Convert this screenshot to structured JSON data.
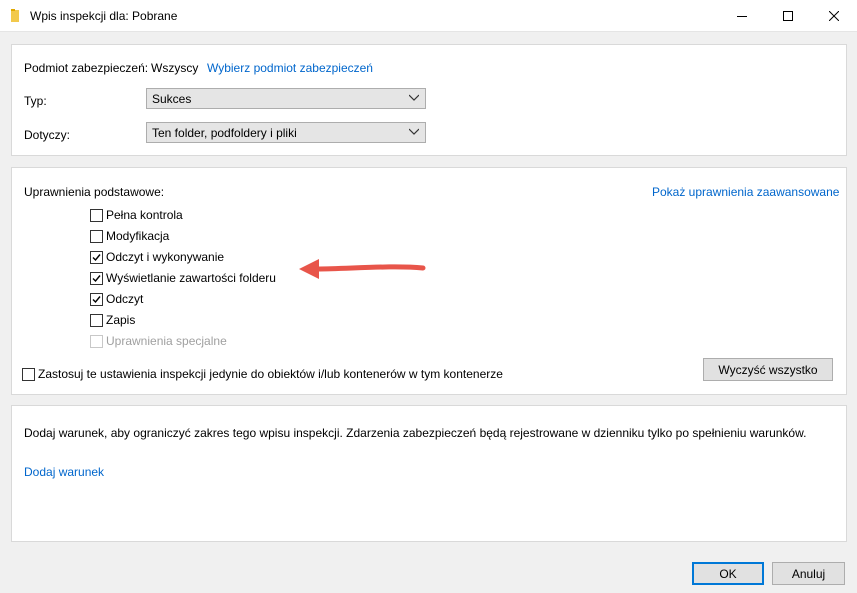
{
  "window": {
    "title": "Wpis inspekcji dla: Pobrane"
  },
  "principal": {
    "label": "Podmiot zabezpieczeń:",
    "value": "Wszyscy",
    "select_link": "Wybierz podmiot zabezpieczeń"
  },
  "type_field": {
    "label": "Typ:",
    "value": "Sukces"
  },
  "applies_field": {
    "label": "Dotyczy:",
    "value": "Ten folder, podfoldery i pliki"
  },
  "permissions": {
    "heading": "Uprawnienia podstawowe:",
    "advanced_link": "Pokaż uprawnienia zaawansowane",
    "items": [
      {
        "label": "Pełna kontrola",
        "checked": false,
        "disabled": false
      },
      {
        "label": "Modyfikacja",
        "checked": false,
        "disabled": false
      },
      {
        "label": "Odczyt i wykonywanie",
        "checked": true,
        "disabled": false
      },
      {
        "label": "Wyświetlanie zawartości folderu",
        "checked": true,
        "disabled": false
      },
      {
        "label": "Odczyt",
        "checked": true,
        "disabled": false
      },
      {
        "label": "Zapis",
        "checked": false,
        "disabled": false
      },
      {
        "label": "Uprawnienia specjalne",
        "checked": false,
        "disabled": true
      }
    ],
    "apply_only": {
      "label": "Zastosuj te ustawienia inspekcji jedynie do obiektów i/lub kontenerów w tym kontenerze",
      "checked": false
    },
    "clear_all": "Wyczyść wszystko"
  },
  "conditions": {
    "description": "Dodaj warunek, aby ograniczyć zakres tego wpisu inspekcji. Zdarzenia zabezpieczeń będą rejestrowane w dzienniku tylko po spełnieniu warunków.",
    "add_link": "Dodaj warunek"
  },
  "footer": {
    "ok": "OK",
    "cancel": "Anuluj"
  },
  "colors": {
    "link": "#0066cc",
    "arrow": "#e8554a",
    "ok_border": "#0078d7"
  }
}
